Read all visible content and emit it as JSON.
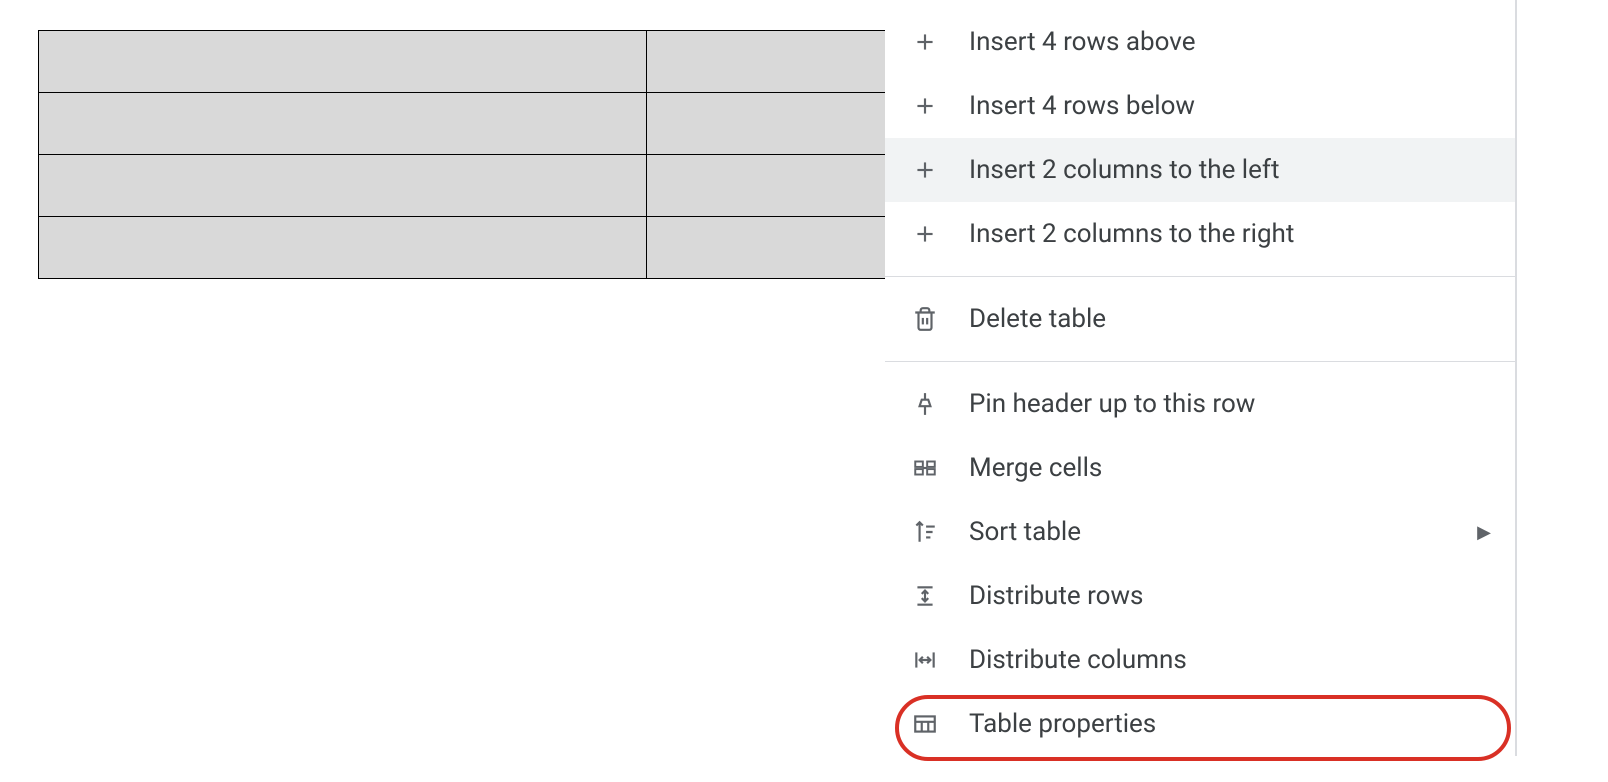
{
  "table": {
    "rows": 4,
    "columns": 2
  },
  "menu": {
    "items": [
      {
        "icon": "plus",
        "label": "Insert 4 rows above"
      },
      {
        "icon": "plus",
        "label": "Insert 4 rows below"
      },
      {
        "icon": "plus",
        "label": "Insert 2 columns to the left",
        "highlighted": true
      },
      {
        "icon": "plus",
        "label": "Insert 2 columns to the right"
      },
      {
        "divider": true
      },
      {
        "icon": "trash",
        "label": "Delete table"
      },
      {
        "divider": true
      },
      {
        "icon": "pin",
        "label": "Pin header up to this row"
      },
      {
        "icon": "merge",
        "label": "Merge cells"
      },
      {
        "icon": "sort",
        "label": "Sort table",
        "submenu": true
      },
      {
        "icon": "distribute-rows",
        "label": "Distribute rows"
      },
      {
        "icon": "distribute-cols",
        "label": "Distribute columns"
      },
      {
        "icon": "table-props",
        "label": "Table properties",
        "circled": true
      }
    ]
  }
}
